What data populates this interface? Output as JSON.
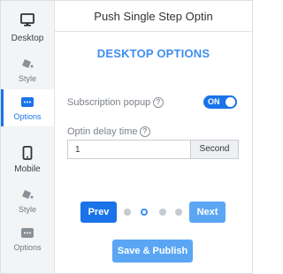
{
  "header": {
    "title": "Push Single Step Optin"
  },
  "sidebar": {
    "items": [
      {
        "label": "Desktop",
        "icon": "monitor-icon"
      },
      {
        "label": "Style",
        "icon": "paint-bucket-icon"
      },
      {
        "label": "Options",
        "icon": "options-icon",
        "active": true
      },
      {
        "label": "Mobile",
        "icon": "phone-icon"
      },
      {
        "label": "Style",
        "icon": "paint-bucket-icon"
      },
      {
        "label": "Options",
        "icon": "options-icon"
      }
    ]
  },
  "main": {
    "section_title": "DESKTOP OPTIONS",
    "subscription_popup": {
      "label": "Subscription popup",
      "toggle_label": "ON",
      "enabled": true
    },
    "optin_delay": {
      "label": "Optin delay time",
      "value": "1",
      "unit": "Second"
    },
    "pagination": {
      "prev_label": "Prev",
      "next_label": "Next",
      "total_steps": 4,
      "current_step": 2
    },
    "publish_label": "Save & Publish"
  },
  "colors": {
    "accent": "#1a73e8",
    "accent_light": "#5aa6f5",
    "title_blue": "#3d8ef0"
  }
}
